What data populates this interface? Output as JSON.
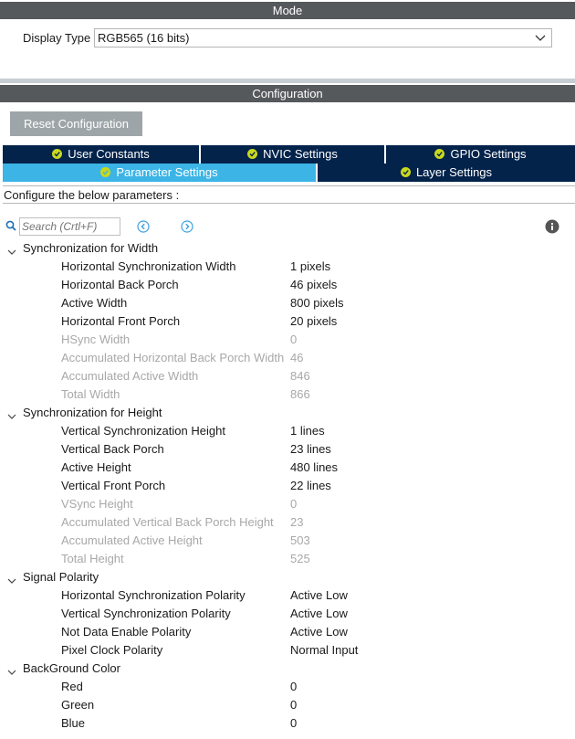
{
  "mode": {
    "title": "Mode",
    "display_type_label": "Display Type",
    "display_type_value": "RGB565 (16 bits)"
  },
  "configuration": {
    "title": "Configuration",
    "reset_label": "Reset Configuration",
    "tabs_row1": [
      {
        "label": "User Constants"
      },
      {
        "label": "NVIC Settings"
      },
      {
        "label": "GPIO Settings"
      }
    ],
    "tabs_row2": [
      {
        "label": "Parameter Settings",
        "active": true
      },
      {
        "label": "Layer Settings",
        "active": false
      }
    ],
    "configure_text": "Configure the below parameters :",
    "search_placeholder": "Search (Crtl+F)"
  },
  "groups": [
    {
      "title": "Synchronization for Width",
      "params": [
        {
          "name": "Horizontal Synchronization Width",
          "value": "1 pixels",
          "enabled": true
        },
        {
          "name": "Horizontal Back Porch",
          "value": "46 pixels",
          "enabled": true
        },
        {
          "name": "Active Width",
          "value": "800 pixels",
          "enabled": true
        },
        {
          "name": "Horizontal Front Porch",
          "value": "20 pixels",
          "enabled": true
        },
        {
          "name": "HSync Width",
          "value": "0",
          "enabled": false
        },
        {
          "name": "Accumulated Horizontal Back Porch Width",
          "value": "46",
          "enabled": false
        },
        {
          "name": "Accumulated Active Width",
          "value": "846",
          "enabled": false
        },
        {
          "name": "Total Width",
          "value": "866",
          "enabled": false
        }
      ]
    },
    {
      "title": "Synchronization for Height",
      "params": [
        {
          "name": "Vertical Synchronization Height",
          "value": "1 lines",
          "enabled": true
        },
        {
          "name": "Vertical Back Porch",
          "value": "23 lines",
          "enabled": true
        },
        {
          "name": "Active Height",
          "value": "480 lines",
          "enabled": true
        },
        {
          "name": "Vertical Front Porch",
          "value": "22 lines",
          "enabled": true
        },
        {
          "name": "VSync Height",
          "value": "0",
          "enabled": false
        },
        {
          "name": "Accumulated Vertical Back Porch Height",
          "value": "23",
          "enabled": false
        },
        {
          "name": "Accumulated Active Height",
          "value": "503",
          "enabled": false
        },
        {
          "name": "Total Height",
          "value": "525",
          "enabled": false
        }
      ]
    },
    {
      "title": "Signal Polarity",
      "params": [
        {
          "name": "Horizontal Synchronization Polarity",
          "value": "Active Low",
          "enabled": true
        },
        {
          "name": "Vertical Synchronization Polarity",
          "value": "Active Low",
          "enabled": true
        },
        {
          "name": "Not Data Enable Polarity",
          "value": "Active Low",
          "enabled": true
        },
        {
          "name": "Pixel Clock Polarity",
          "value": "Normal Input",
          "enabled": true
        }
      ]
    },
    {
      "title": "BackGround Color",
      "params": [
        {
          "name": "Red",
          "value": "0",
          "enabled": true
        },
        {
          "name": "Green",
          "value": "0",
          "enabled": true
        },
        {
          "name": "Blue",
          "value": "0",
          "enabled": true
        }
      ]
    }
  ],
  "colors": {
    "header_bar": "#55595c",
    "tab_dark": "#03234b",
    "tab_active": "#3cb4e6",
    "check_badge": "#c9d81d",
    "disabled_text": "#a8a8a8"
  },
  "icons": {
    "search": "search-icon",
    "previous": "chevron-left-circle-icon",
    "next": "chevron-right-circle-icon",
    "info": "info-icon",
    "dropdown": "chevron-down-icon",
    "collapse": "caret-down-icon",
    "check": "check-circle-icon"
  }
}
